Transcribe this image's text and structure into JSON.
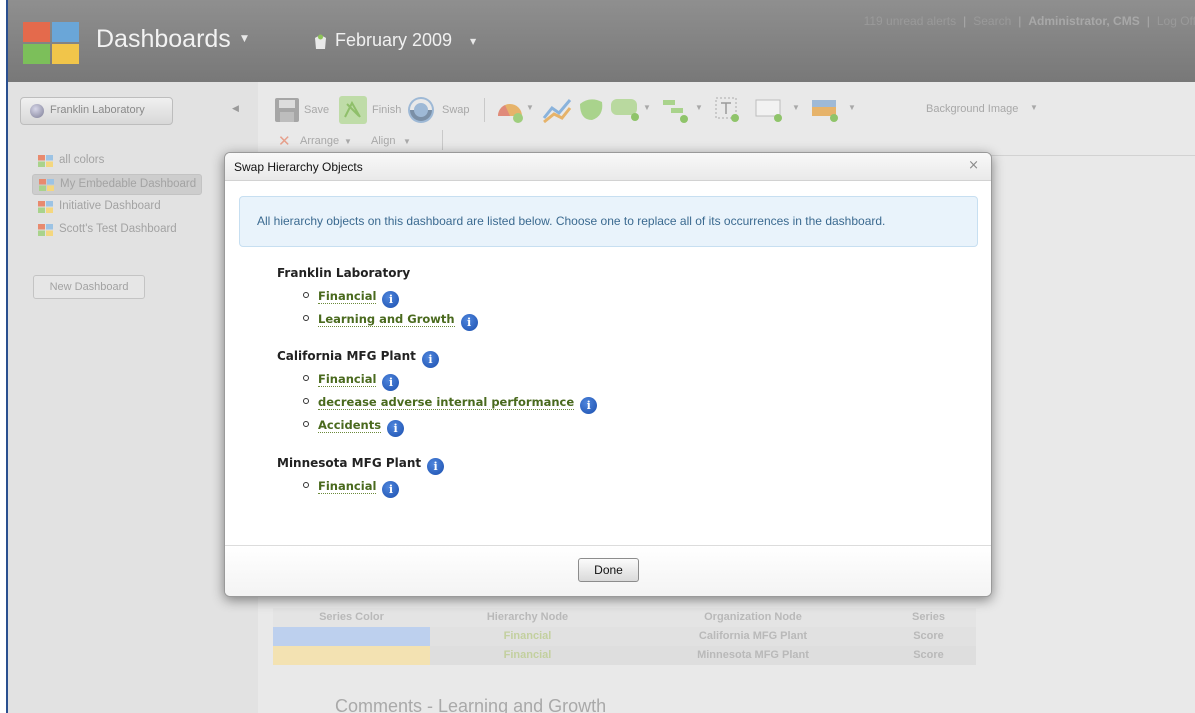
{
  "header": {
    "app_title": "Dashboards",
    "period_label": "February 2009",
    "links": {
      "alerts": "119 unread alerts",
      "search": "Search",
      "user": "Administrator, CMS",
      "logoff": "Log Off",
      "separator": "|"
    }
  },
  "sidebar": {
    "scope_label": "Franklin Laboratory",
    "dashboards": [
      {
        "label": "all colors",
        "selected": false
      },
      {
        "label": "My Embedable Dashboard",
        "selected": true
      },
      {
        "label": "Initiative Dashboard",
        "selected": false
      },
      {
        "label": "Scott's Test Dashboard",
        "selected": false
      }
    ],
    "new_dashboard_label": "New Dashboard"
  },
  "toolbar": {
    "save": "Save",
    "finish": "Finish",
    "swap": "Swap",
    "background_image": "Background Image",
    "arrange": "Arrange",
    "align": "Align"
  },
  "series_table": {
    "headers": [
      "Series Color",
      "Hierarchy Node",
      "Organization Node",
      "Series"
    ],
    "rows": [
      {
        "color": "#bdd0ee",
        "hierarchy": "Financial",
        "organization": "California MFG Plant",
        "series": "Score"
      },
      {
        "color": "#f3e2b2",
        "hierarchy": "Financial",
        "organization": "Minnesota MFG Plant",
        "series": "Score"
      }
    ]
  },
  "comments_title": "Comments - Learning and Growth",
  "modal": {
    "title": "Swap Hierarchy Objects",
    "close_glyph": "×",
    "info_text": "All hierarchy objects on this dashboard are listed below. Choose one to replace all of its occurrences in the dashboard.",
    "info_glyph": "i",
    "groups": [
      {
        "title": "Franklin Laboratory",
        "has_info": false,
        "items": [
          "Financial",
          "Learning and Growth"
        ]
      },
      {
        "title": "California MFG Plant",
        "has_info": true,
        "items": [
          "Financial",
          "decrease adverse internal performance",
          "Accidents"
        ]
      },
      {
        "title": "Minnesota MFG Plant",
        "has_info": true,
        "items": [
          "Financial"
        ]
      }
    ],
    "done_label": "Done"
  },
  "colors": {
    "link_green": "#4a6a1e",
    "info_blue": "#1b4fae",
    "info_box_bg": "#e9f3fb",
    "info_box_text": "#3b6a90"
  }
}
